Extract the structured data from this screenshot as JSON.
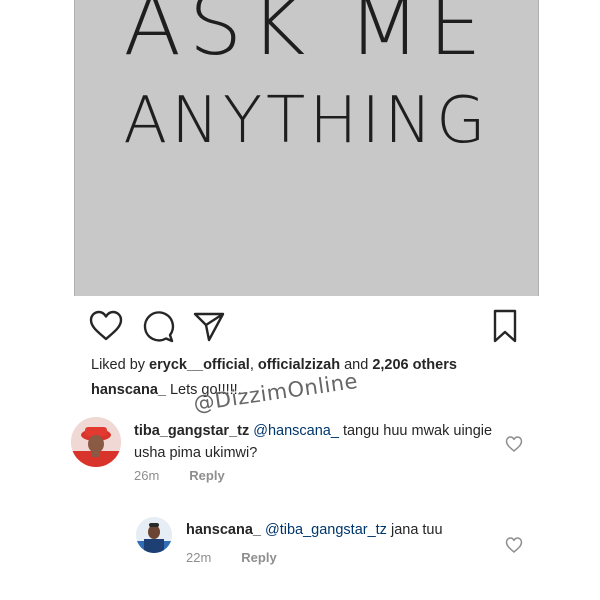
{
  "post": {
    "image_text_line1": "ASK ME",
    "image_text_line2": "ANYTHING"
  },
  "actions": {
    "icons": [
      "heart-icon",
      "comment-icon",
      "share-icon",
      "bookmark-icon"
    ]
  },
  "likes": {
    "prefix": "Liked by ",
    "user1": "eryck__official",
    "separator": ", ",
    "user2": "officialzizah",
    "and": " and ",
    "others": "2,206 others"
  },
  "caption": {
    "username": "hanscana_",
    "text": " Lets go!!!!!."
  },
  "watermark": "@DizzimOnline",
  "comments": [
    {
      "username": "tiba_gangstar_tz",
      "mention": "@hanscana_",
      "text": "  tangu huu mwak uingie usha pima ukimwi?",
      "time": "26m",
      "reply": "Reply"
    },
    {
      "username": "hanscana_",
      "mention": "@tiba_gangstar_tz",
      "text": " jana tuu",
      "time": "22m",
      "reply": "Reply"
    }
  ],
  "colors": {
    "post_bg": "#c8c8c8",
    "mention": "#00376b",
    "meta": "#8e8e8e"
  }
}
